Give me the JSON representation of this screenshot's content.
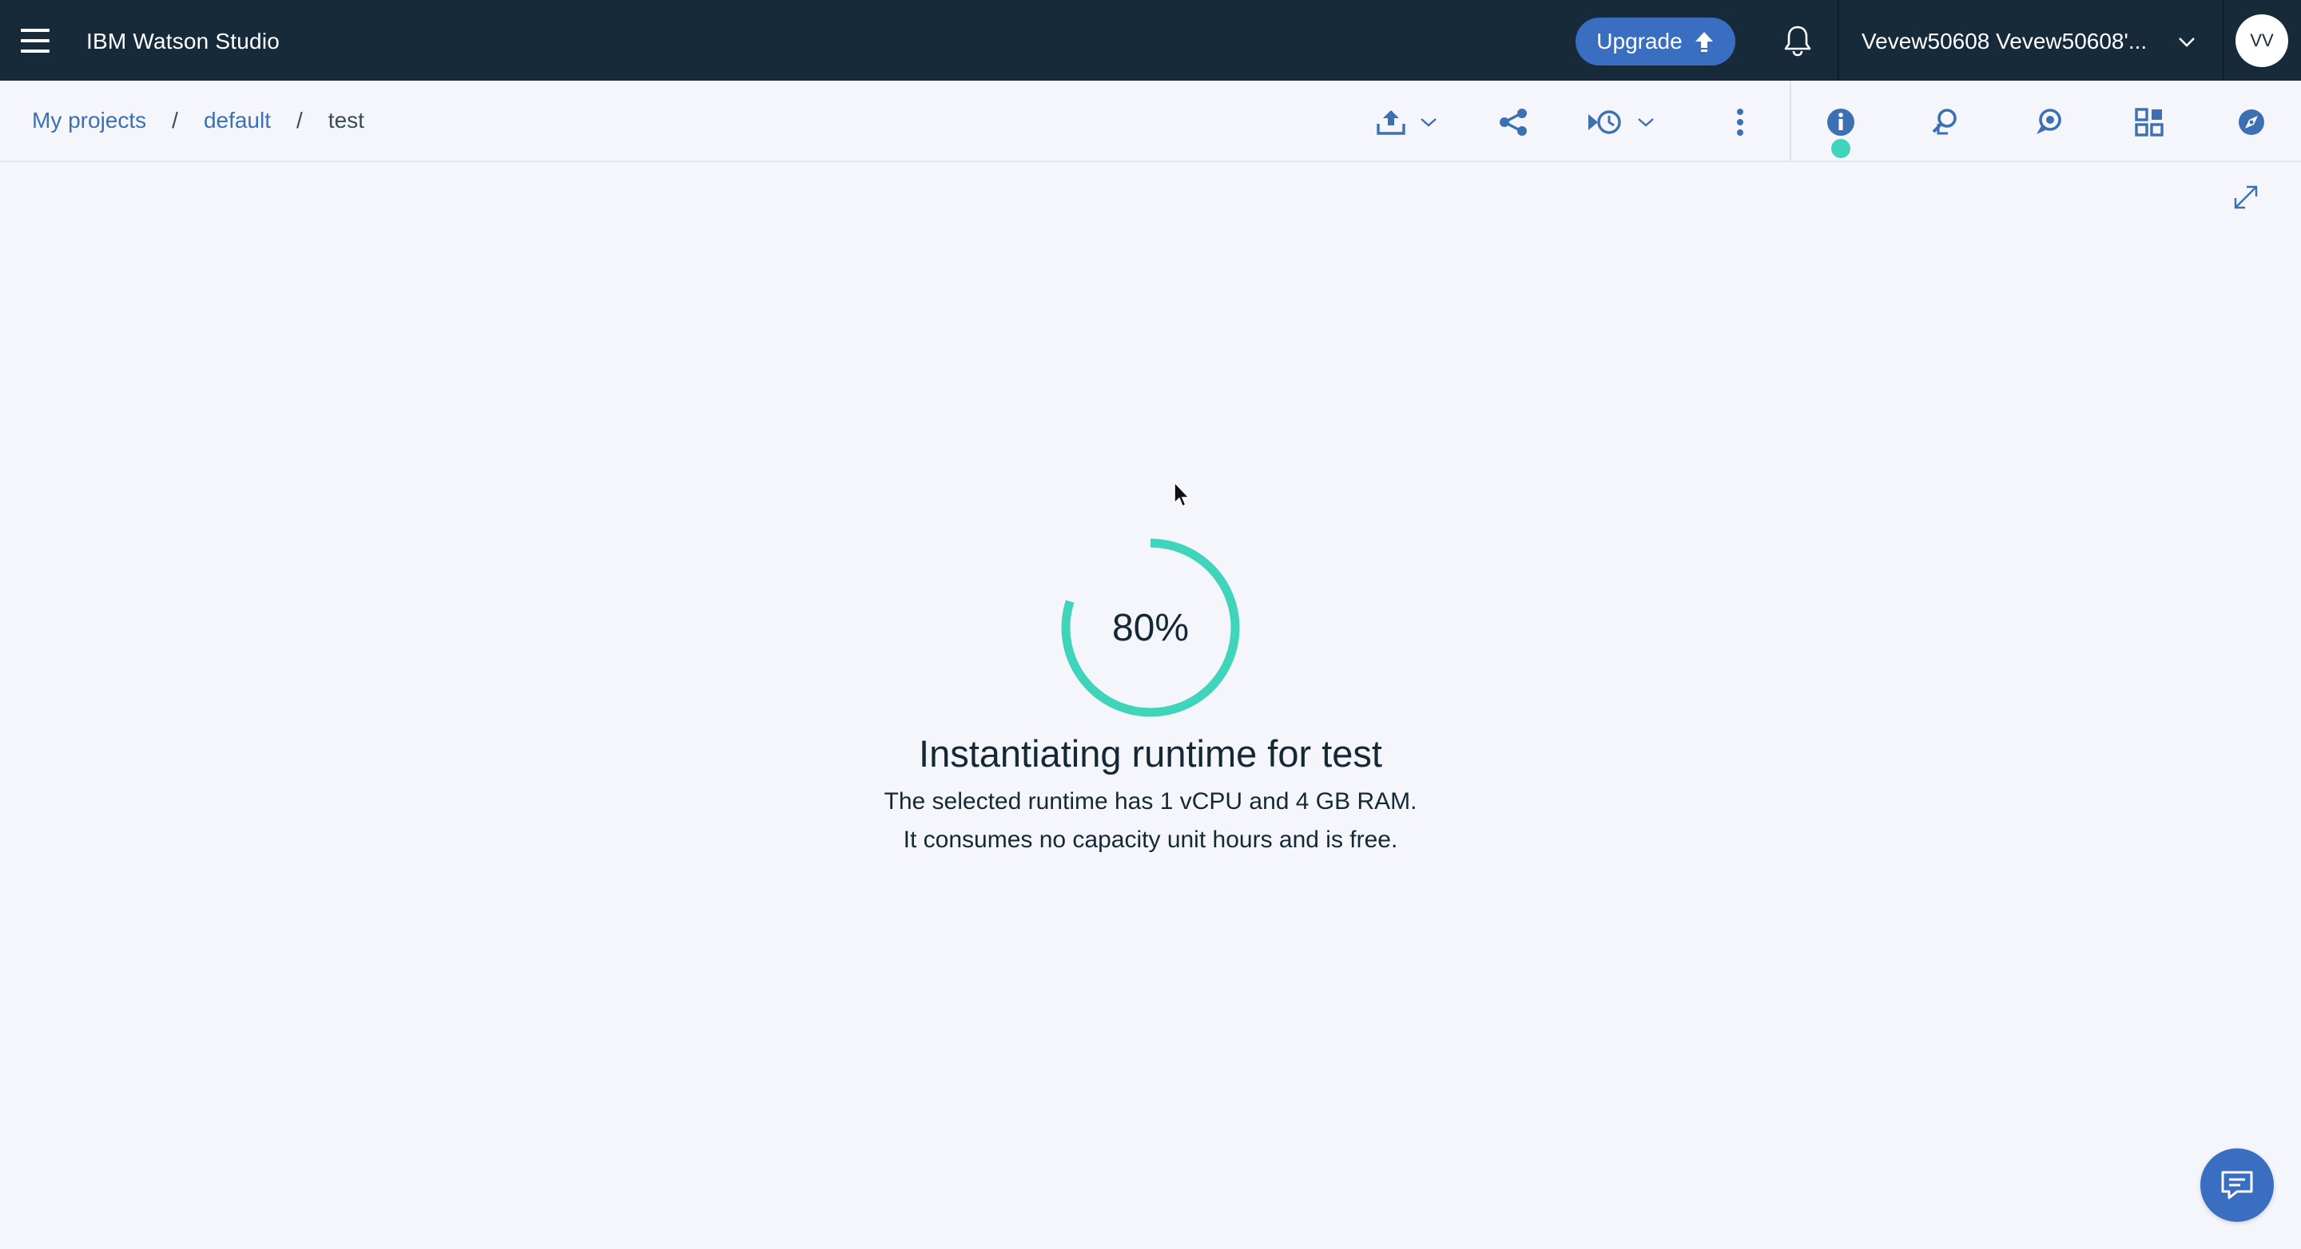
{
  "header": {
    "app_title": "IBM Watson Studio",
    "upgrade_label": "Upgrade",
    "account_name": "Vevew50608 Vevew50608'...",
    "avatar_initials": "VV",
    "background_color": "#172a3a",
    "upgrade_color": "#3a6ec1"
  },
  "breadcrumb": {
    "items": [
      "My projects",
      "default"
    ],
    "current": "test",
    "separator": "/"
  },
  "toolbar": {
    "icons": [
      "upload-icon",
      "share-icon",
      "version-history-icon",
      "overflow-menu-icon",
      "info-icon",
      "find-replace-icon",
      "comments-icon",
      "code-snippets-icon",
      "data-explorer-icon"
    ],
    "status_color": "#40d5bb"
  },
  "loader": {
    "percent_label": "80%",
    "progress": 0.8,
    "title": "Instantiating runtime for test",
    "line1": "The selected runtime has 1 vCPU and 4 GB RAM.",
    "line2": "It consumes no capacity unit hours and is free.",
    "ring_color": "#40d5bb"
  },
  "chat": {
    "icon": "chat-icon",
    "color": "#3a6ec1"
  }
}
